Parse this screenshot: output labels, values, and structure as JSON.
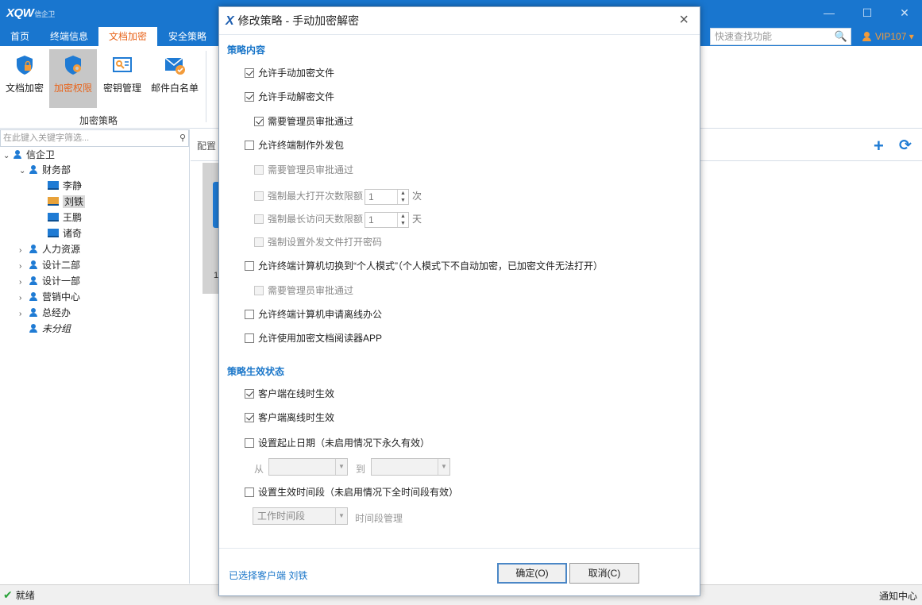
{
  "app": {
    "logo_text": "XQW",
    "logo_sub": "信企卫",
    "window_controls": {
      "minimize": "—",
      "maximize": "☐",
      "close": "✕"
    }
  },
  "menu": {
    "tabs": [
      {
        "label": "首页"
      },
      {
        "label": "终端信息"
      },
      {
        "label": "文档加密",
        "active": true
      },
      {
        "label": "安全策略"
      }
    ],
    "search_placeholder": "快速查找功能",
    "vip_label": "VIP107 ▾"
  },
  "ribbon": {
    "buttons": [
      {
        "label": "文档加密",
        "icon": "shield-lock-icon"
      },
      {
        "label": "加密权限",
        "icon": "shield-gear-icon",
        "selected": true
      },
      {
        "label": "密钥管理",
        "icon": "key-card-icon"
      },
      {
        "label": "邮件白名单",
        "icon": "mail-check-icon"
      }
    ],
    "group_label": "加密策略"
  },
  "tree": {
    "filter_placeholder": "在此键入关键字筛选...",
    "nodes": [
      {
        "label": "信企卫",
        "level": 0,
        "expanded": true,
        "type": "group"
      },
      {
        "label": "财务部",
        "level": 1,
        "expanded": true,
        "type": "group"
      },
      {
        "label": "李静",
        "level": 2,
        "type": "pc"
      },
      {
        "label": "刘铁",
        "level": 2,
        "type": "pc",
        "selected": true
      },
      {
        "label": "王鹏",
        "level": 2,
        "type": "pc"
      },
      {
        "label": "诸奇",
        "level": 2,
        "type": "pc"
      },
      {
        "label": "人力资源",
        "level": 1,
        "expanded": false,
        "type": "group"
      },
      {
        "label": "设计二部",
        "level": 1,
        "expanded": false,
        "type": "group"
      },
      {
        "label": "设计一部",
        "level": 1,
        "expanded": false,
        "type": "group"
      },
      {
        "label": "营销中心",
        "level": 1,
        "expanded": false,
        "type": "group"
      },
      {
        "label": "总经办",
        "level": 1,
        "expanded": false,
        "type": "group"
      },
      {
        "label": "未分组",
        "level": 1,
        "type": "group",
        "italic": true
      }
    ]
  },
  "content": {
    "config_label": "配置",
    "card_number": "1"
  },
  "status": {
    "ready": "就绪",
    "notify": "通知中心"
  },
  "dialog": {
    "title": "修改策略 - 手动加密解密",
    "close": "×",
    "section1": "策略内容",
    "opt_manual_encrypt": "允许手动加密文件",
    "opt_manual_decrypt": "允许手动解密文件",
    "opt_decrypt_approval": "需要管理员审批通过",
    "opt_outgoing": "允许终端制作外发包",
    "opt_outgoing_approval": "需要管理员审批通过",
    "opt_max_open": "强制最大打开次数限额",
    "max_open_value": "1",
    "max_open_unit": "次",
    "opt_max_days": "强制最长访问天数限额",
    "max_days_value": "1",
    "max_days_unit": "天",
    "opt_password": "强制设置外发文件打开密码",
    "opt_personal_mode": "允许终端计算机切换到“个人模式”（个人模式下不自动加密，已加密文件无法打开）",
    "opt_personal_approval": "需要管理员审批通过",
    "opt_offline": "允许终端计算机申请离线办公",
    "opt_reader_app": "允许使用加密文档阅读器APP",
    "section2": "策略生效状态",
    "opt_online_effect": "客户端在线时生效",
    "opt_offline_effect": "客户端离线时生效",
    "opt_date_range": "设置起止日期（未启用情况下永久有效）",
    "from_label": "从",
    "to_label": "到",
    "from_value": "",
    "to_value": "",
    "opt_time_period": "设置生效时间段（未启用情况下全时间段有效）",
    "period_value": "工作时间段",
    "period_manage": "时间段管理",
    "selected_client": "已选择客户端 刘铁",
    "ok": "确定(O)",
    "cancel": "取消(C)"
  },
  "colors": {
    "brand": "#1976cf",
    "accent_orange": "#e8641b",
    "section_blue": "#1a76c9"
  }
}
